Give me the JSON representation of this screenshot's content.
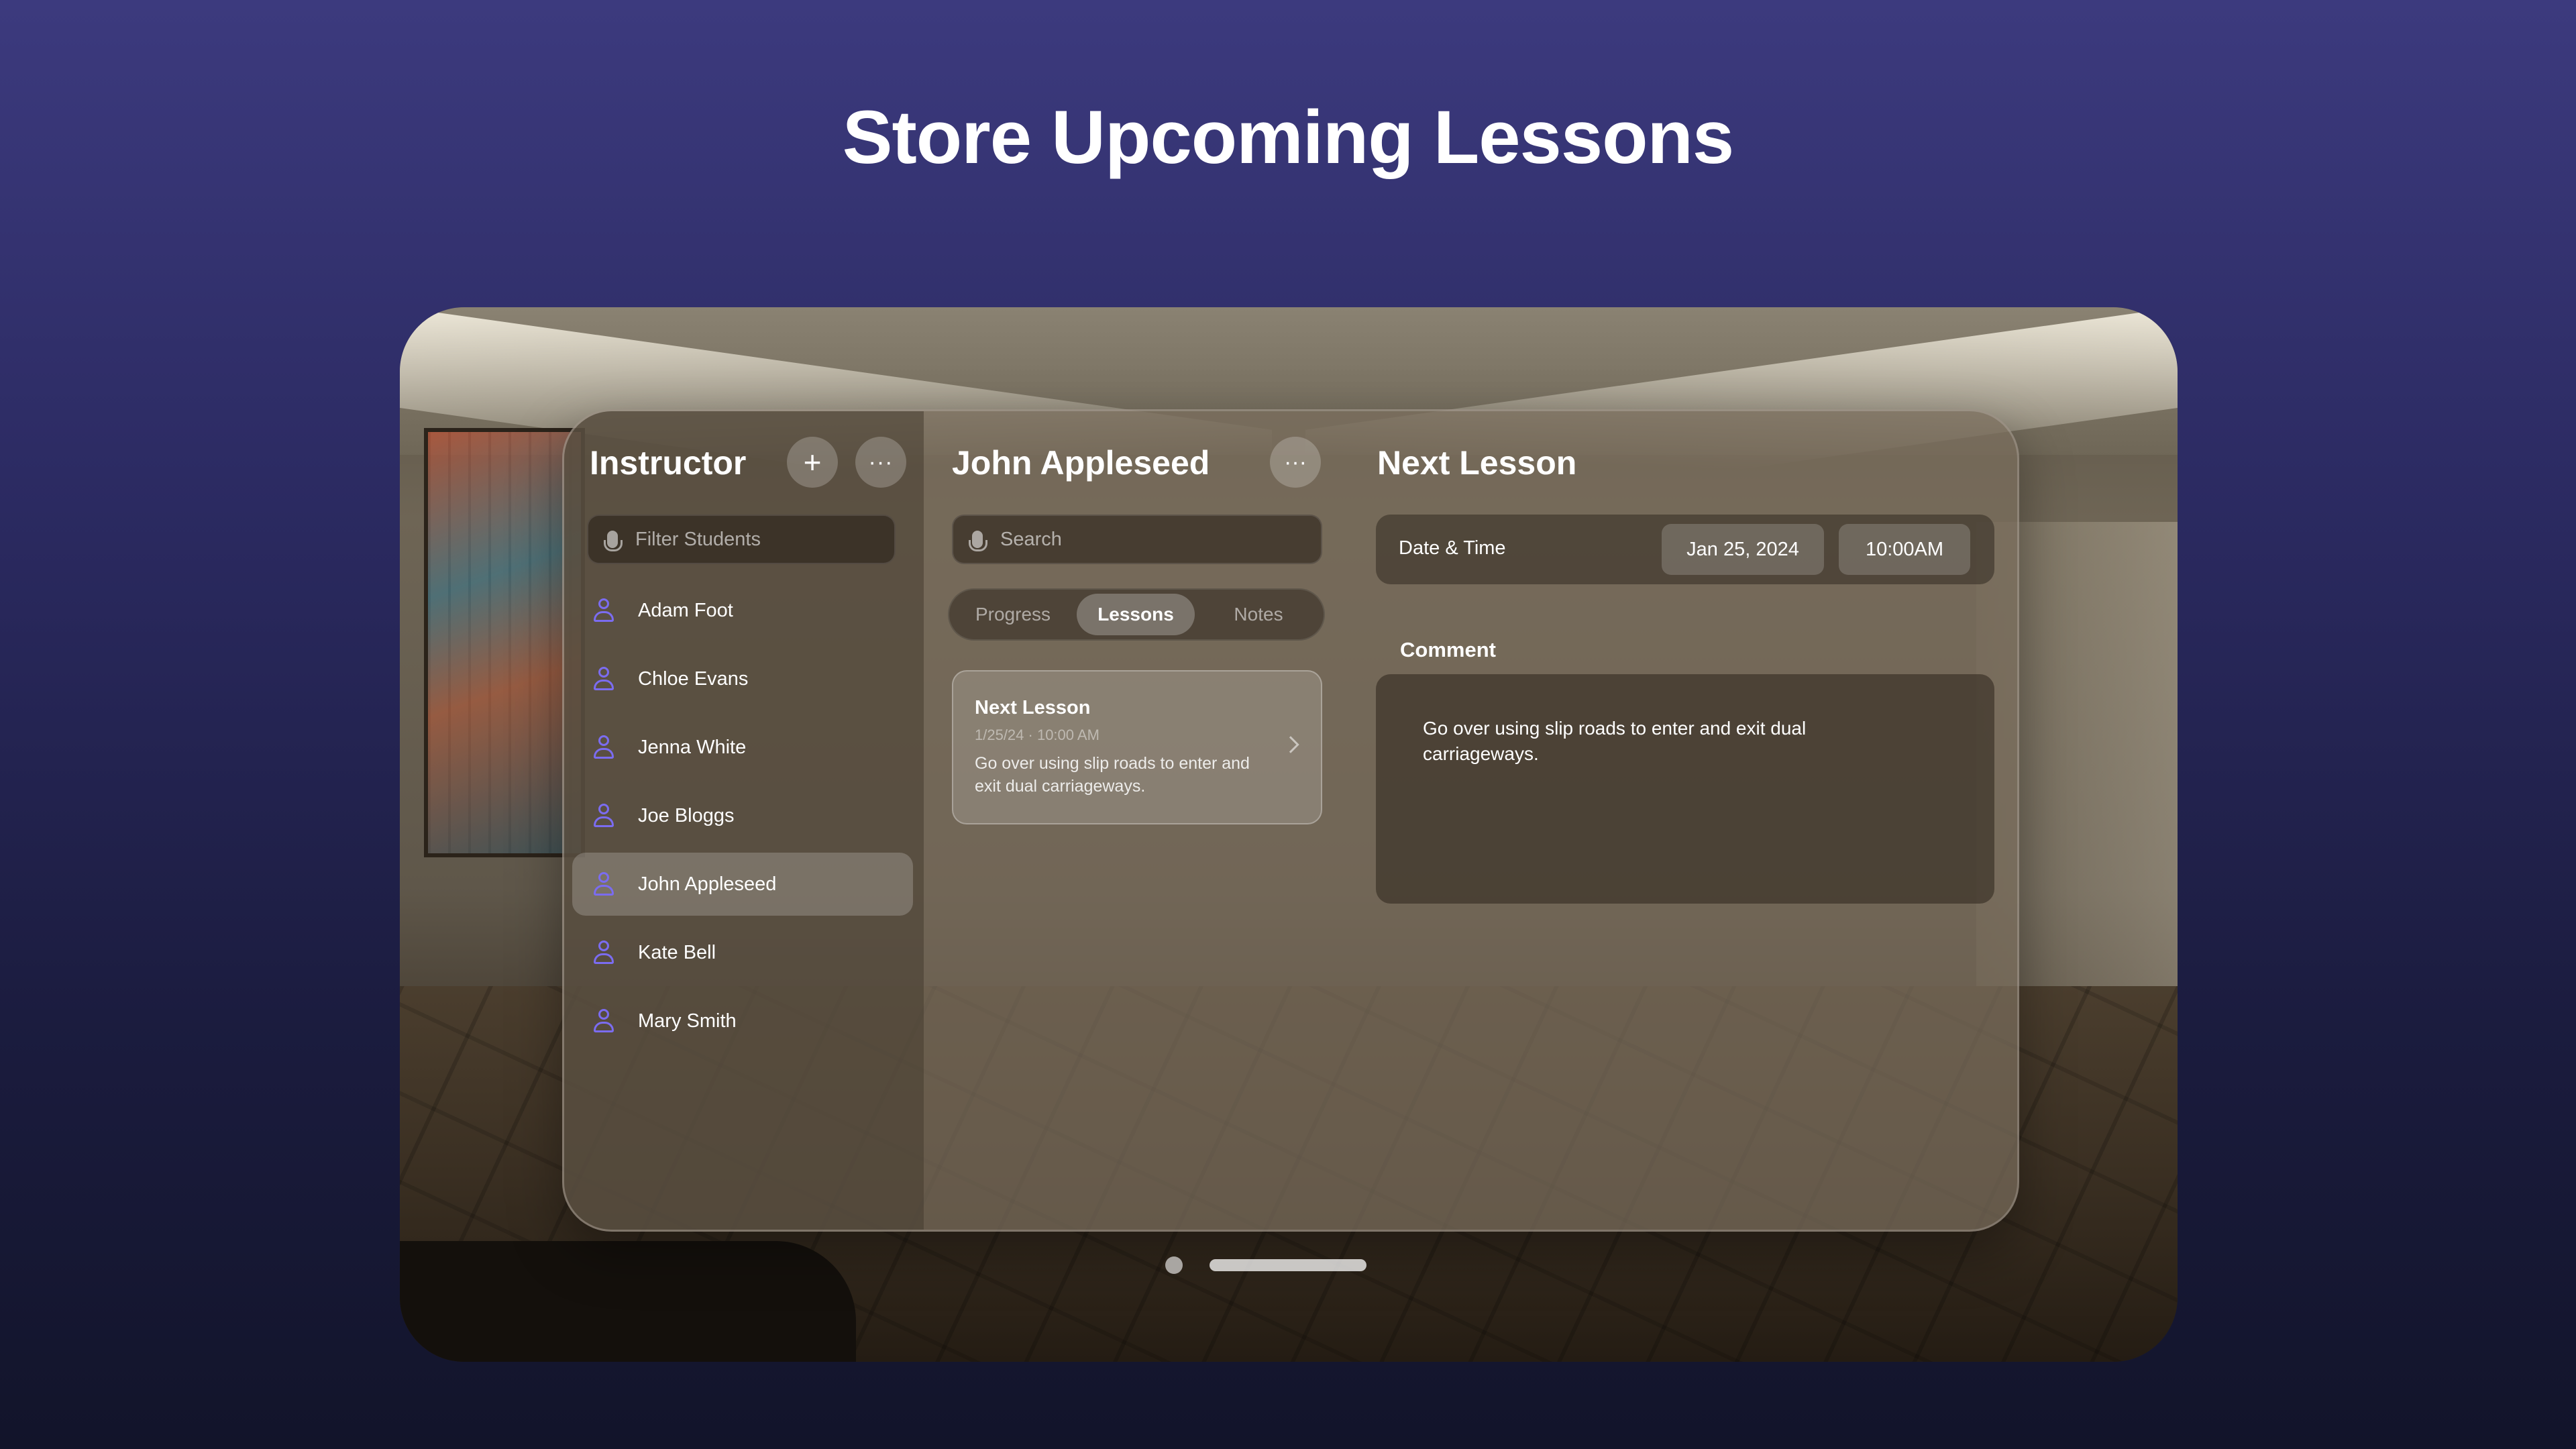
{
  "headline": "Store Upcoming Lessons",
  "sidebar": {
    "title": "Instructor",
    "add_icon": "plus-icon",
    "more_icon": "ellipsis-icon",
    "filter_placeholder": "Filter Students",
    "students": [
      {
        "name": "Adam Foot",
        "selected": false
      },
      {
        "name": "Chloe Evans",
        "selected": false
      },
      {
        "name": "Jenna White",
        "selected": false
      },
      {
        "name": "Joe Bloggs",
        "selected": false
      },
      {
        "name": "John Appleseed",
        "selected": true
      },
      {
        "name": "Kate Bell",
        "selected": false
      },
      {
        "name": "Mary Smith",
        "selected": false
      }
    ]
  },
  "student_panel": {
    "title": "John Appleseed",
    "more_icon": "ellipsis-icon",
    "search_placeholder": "Search",
    "tabs": [
      "Progress",
      "Lessons",
      "Notes"
    ],
    "active_tab": "Lessons",
    "lesson_card": {
      "title": "Next Lesson",
      "date": "1/25/24 · 10:00 AM",
      "text": "Go over using slip roads to enter and exit dual carriageways."
    }
  },
  "detail_panel": {
    "title": "Next Lesson",
    "date_label": "Date & Time",
    "date_value": "Jan 25, 2024",
    "time_value": "10:00AM",
    "comment_label": "Comment",
    "comment_text": "Go over using slip roads to enter and exit dual carriageways."
  },
  "colors": {
    "accent": "#7b6cf0",
    "background_top": "#3c3a7e",
    "background_bottom": "#12142a"
  }
}
